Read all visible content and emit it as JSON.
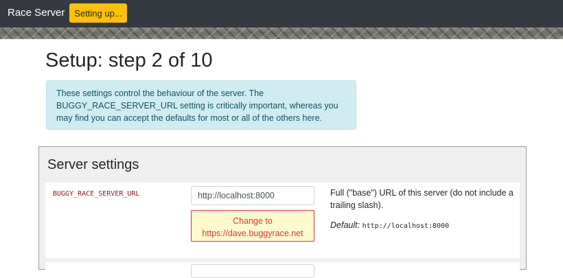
{
  "navbar": {
    "brand": "Race Server",
    "status_button": "Setting up..."
  },
  "page": {
    "title": "Setup: step 2 of 10",
    "info": "These settings control the behaviour of the server. The BUGGY_RACE_SERVER_URL setting is critically important, whereas you may find you can accept the defaults for most or all of the others here."
  },
  "panel": {
    "title": "Server settings",
    "settings": [
      {
        "name": "BUGGY_RACE_SERVER_URL",
        "value": "http://localhost:8000",
        "change_line1": "Change to",
        "change_line2": "https://dave.buggyrace.net",
        "description": "Full (\"base\") URL of this server (do not include a trailing slash).",
        "default_label": "Default:",
        "default_value": "http://localhost:8000"
      }
    ]
  },
  "colors": {
    "navbar": "#343a40",
    "status_button": "#ffc107",
    "alert_bg": "#d1ecf1",
    "alert_text": "#0c5460",
    "setting_name": "#8b1a1a",
    "change_border": "#dc3545",
    "change_bg": "#fffacd"
  }
}
